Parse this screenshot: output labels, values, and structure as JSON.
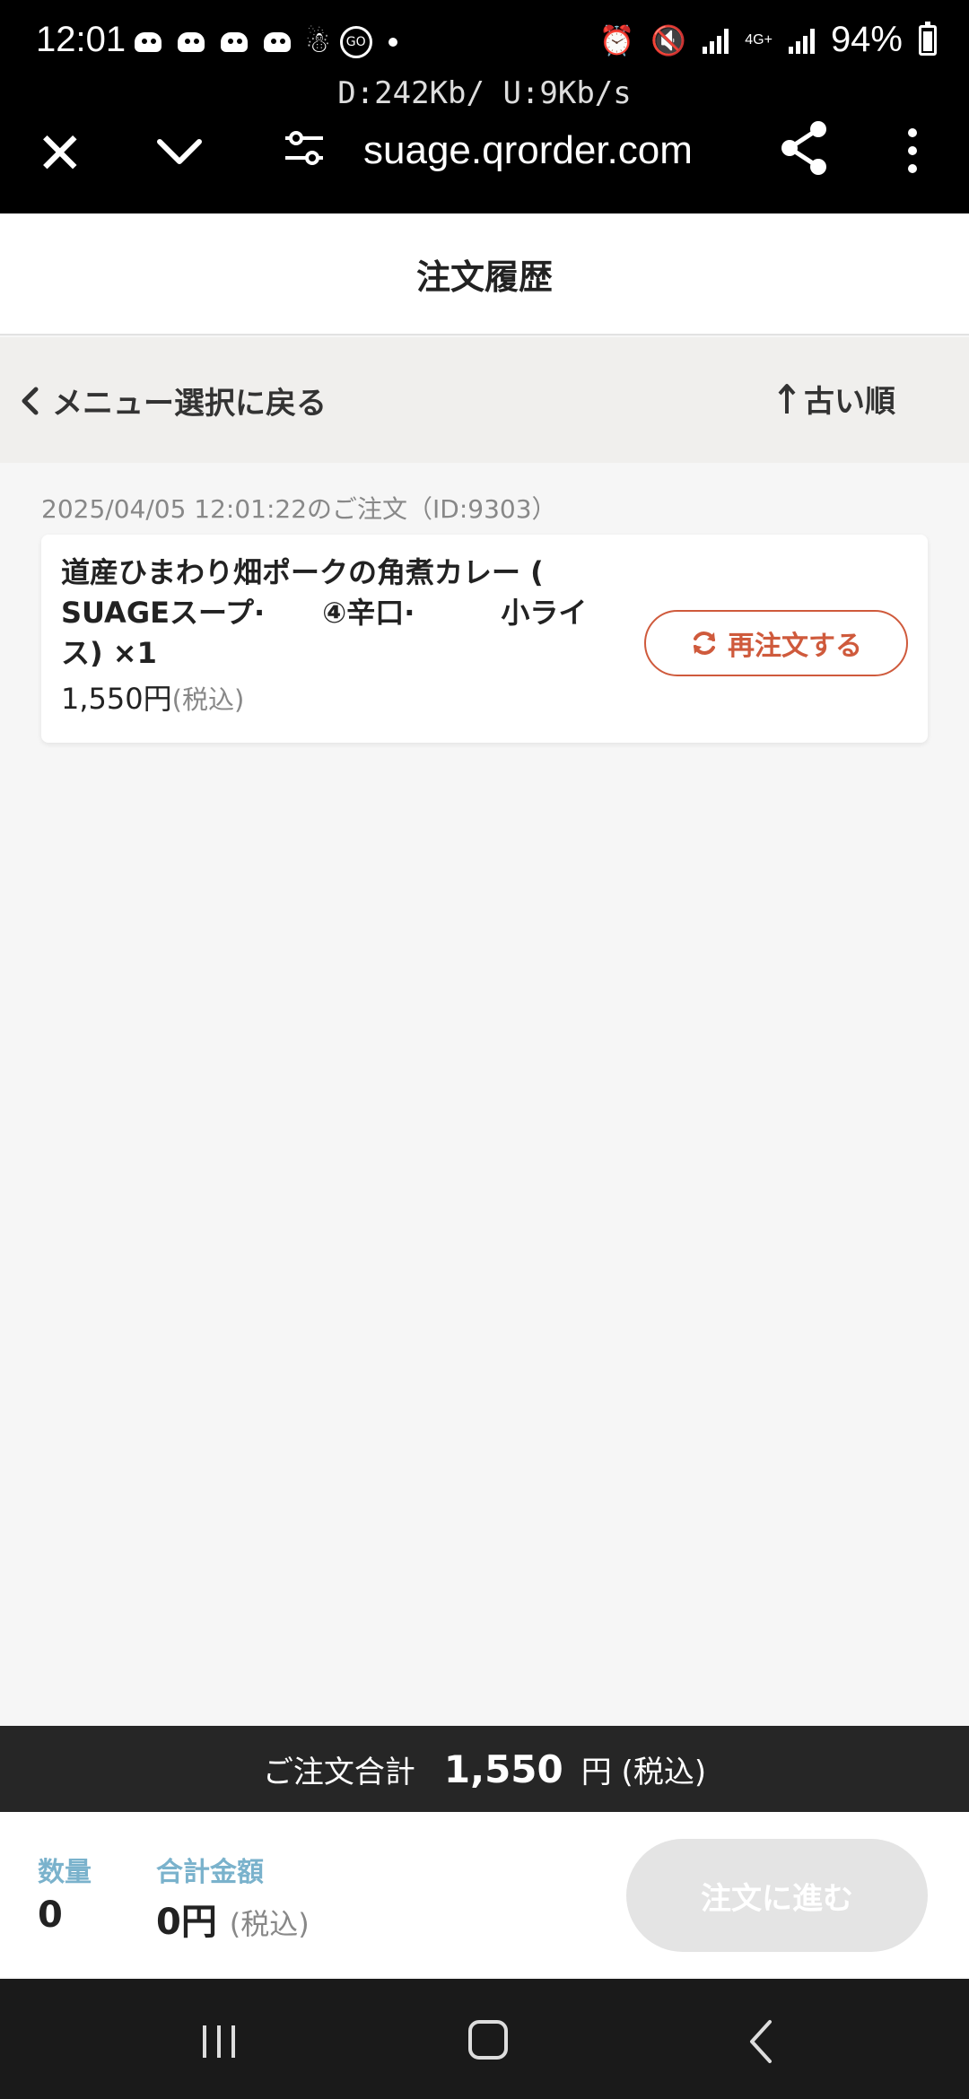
{
  "status_bar": {
    "time": "12:01",
    "notif_go": "GO",
    "battery": "94%",
    "network": "4G+"
  },
  "netspeed": "D:242Kb/ U:9Kb/s",
  "browser": {
    "url": "suage.qrorder.com"
  },
  "header": {
    "title": "注文履歴"
  },
  "subbar": {
    "back_label": "メニュー選択に戻る",
    "sort_label": "古い順"
  },
  "order": {
    "meta": "2025/04/05 12:01:22のご注文（ID:9303）",
    "item_name": "道産ひまわり畑ポークの角煮カレー ( SUAGEスープ·　　④辛口·　　　小ライス) ×1",
    "price": "1,550円",
    "price_tax": "(税込)",
    "reorder_label": "再注文する"
  },
  "total_bar": {
    "label": "ご注文合計",
    "amount": "1,550",
    "suffix": "円 (税込)"
  },
  "cart": {
    "qty_label": "数量",
    "qty_value": "0",
    "sum_label": "合計金額",
    "sum_value": "0円",
    "sum_tax": "(税込)",
    "proceed_label": "注文に進む"
  },
  "colors": {
    "accent": "#cf5a3c",
    "label_blue": "#7ab2cc",
    "total_bar_bg": "#262626"
  }
}
